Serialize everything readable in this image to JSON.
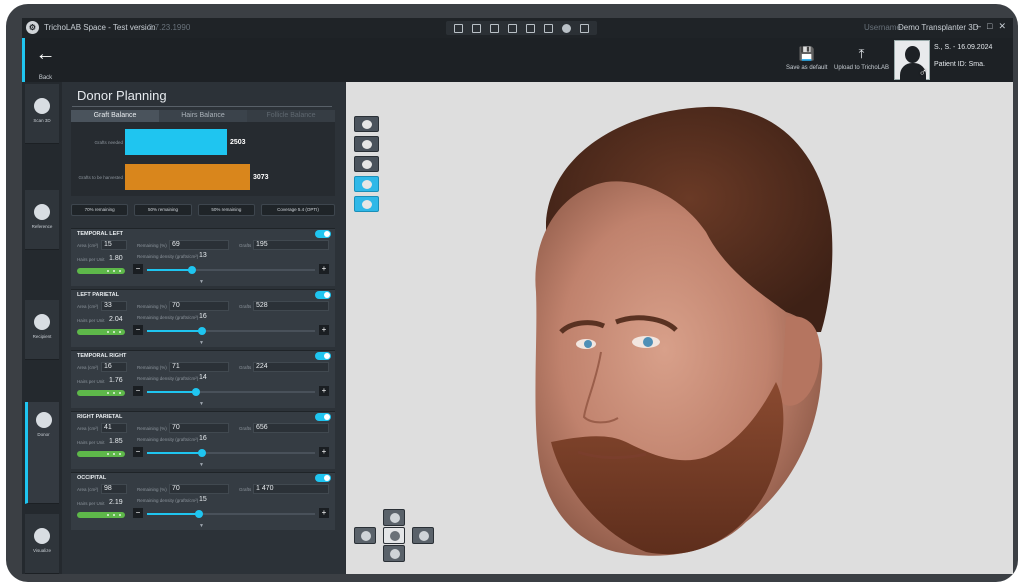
{
  "titlebar": {
    "app_title": "TrichoLAB Space - Test version",
    "version": "2.7.23.1990",
    "user_label": "Username",
    "user_name": "Demo Transplanter 3D",
    "minimize": "–",
    "maximize": "□",
    "close": "✕"
  },
  "header": {
    "back_label": "Back",
    "save_default_label": "Save as default",
    "upload_label": "Upload to TrichoLAB",
    "patient_name_date": "S., S. - 16.09.2024",
    "patient_id": "Patient ID: Sma."
  },
  "sidebar": {
    "items": [
      {
        "label": "Scan 3D"
      },
      {
        "label": "Reference"
      },
      {
        "label": "Recipient"
      },
      {
        "label": "Donor"
      },
      {
        "label": "Visualize"
      }
    ]
  },
  "panel": {
    "title": "Donor Planning",
    "tabs": [
      "Graft Balance",
      "Hairs Balance",
      "Follicle Balance"
    ],
    "chart_data": {
      "type": "bar",
      "categories": [
        "Grafts needed",
        "Grafts to be harvested"
      ],
      "values": [
        2503,
        3073
      ],
      "value_labels": [
        "2503",
        "3073"
      ],
      "colors": [
        "#1fc5f0",
        "#d9861c"
      ],
      "xlim": [
        0,
        3200
      ]
    },
    "summary": [
      "70% remaining",
      "50% remaining",
      "50% remaining",
      "Coverage 5.4 (OPTI)"
    ],
    "labels": {
      "area": "Area (cm²)",
      "remaining": "Remaining (%)",
      "grafts": "Grafts",
      "hairs_per_unit": "Hairs per Unit",
      "remaining_density": "Remaining density (grafts/cm²)"
    },
    "regions": [
      {
        "name": "TEMPORAL LEFT",
        "area": "15",
        "remaining": "69",
        "grafts": "195",
        "hairs": "1.80",
        "density": "13",
        "slider": 0.27
      },
      {
        "name": "LEFT PARIETAL",
        "area": "33",
        "remaining": "70",
        "grafts": "528",
        "hairs": "2.04",
        "density": "16",
        "slider": 0.33
      },
      {
        "name": "TEMPORAL RIGHT",
        "area": "16",
        "remaining": "71",
        "grafts": "224",
        "hairs": "1.76",
        "density": "14",
        "slider": 0.29
      },
      {
        "name": "RIGHT PARIETAL",
        "area": "41",
        "remaining": "70",
        "grafts": "656",
        "hairs": "1.85",
        "density": "16",
        "slider": 0.33
      },
      {
        "name": "OCCIPITAL",
        "area": "98",
        "remaining": "70",
        "grafts": "1 470",
        "hairs": "2.19",
        "density": "15",
        "slider": 0.31
      }
    ]
  },
  "colors": {
    "accent": "#1fc5f0",
    "harvest": "#d9861c",
    "toggle_on": "#1fc5f0",
    "hpu_pill": "#5eb84a"
  }
}
